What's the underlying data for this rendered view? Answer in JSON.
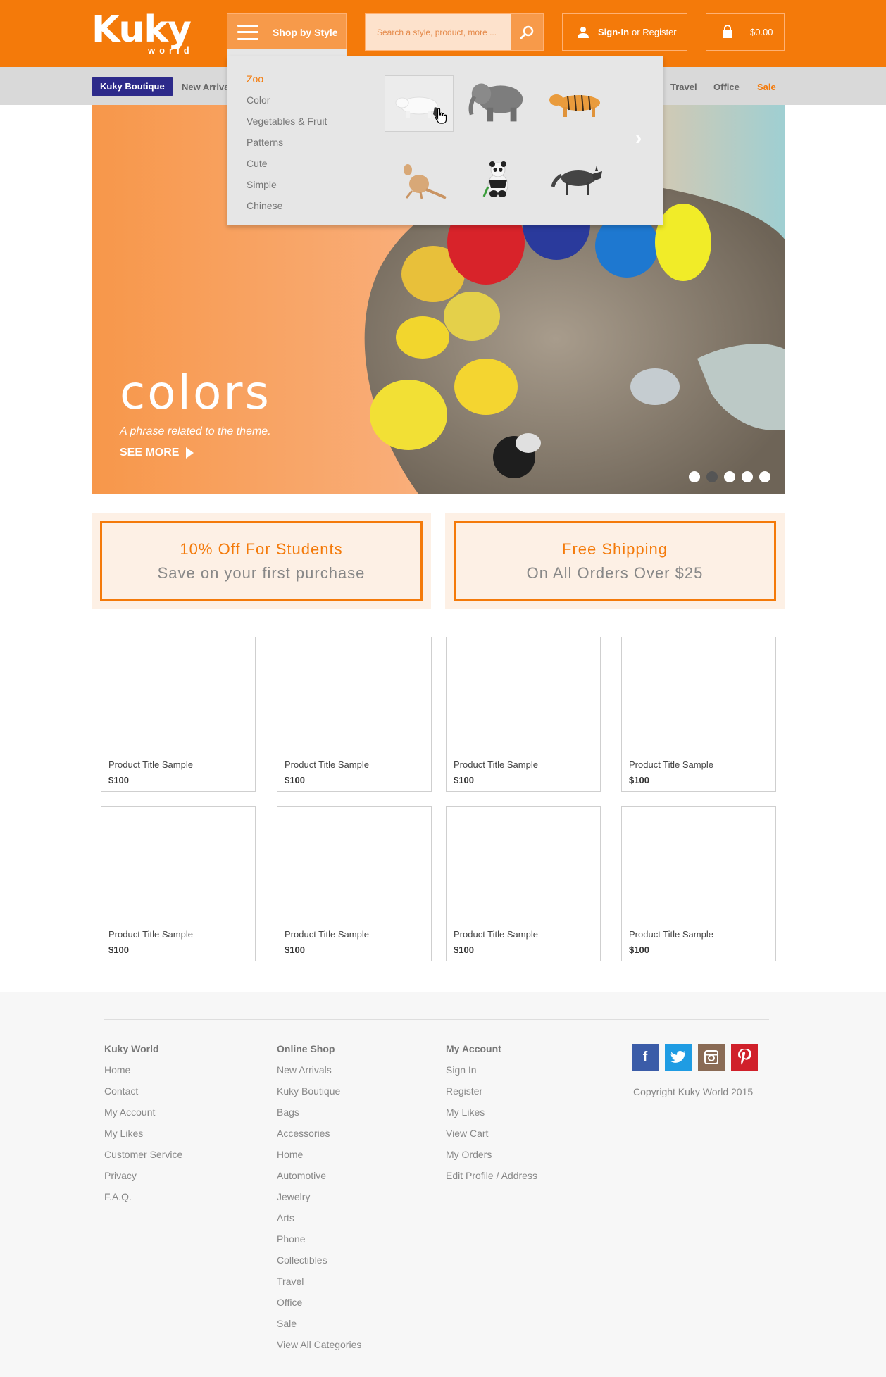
{
  "header": {
    "logo_main": "Kuky",
    "logo_sub": "world",
    "shop_by_style": "Shop by Style",
    "search_placeholder": "Search a style, product, more ...",
    "signin": "Sign-In",
    "or_register": "or Register",
    "cart_total": "$0.00"
  },
  "catbar": {
    "boutique": "Kuky Boutique",
    "new_arrivals": "New Arriva",
    "travel": "Travel",
    "office": "Office",
    "sale": "Sale"
  },
  "dropdown": {
    "items": [
      "Zoo",
      "Color",
      "Vegetables & Fruit",
      "Patterns",
      "Cute",
      "Simple",
      "Chinese"
    ],
    "active": "Zoo",
    "thumbnails": [
      "polar-bear",
      "elephant",
      "tiger",
      "kangaroo",
      "panda",
      "wolf"
    ]
  },
  "hero": {
    "title": "colors",
    "phrase": "A phrase related to the theme.",
    "see_more": "SEE MORE",
    "slides_total": 5,
    "active_slide": 2
  },
  "promos": [
    {
      "headline": "10% Off For Students",
      "sub": "Save on your first purchase"
    },
    {
      "headline": "Free Shipping",
      "sub": "On All Orders Over $25"
    }
  ],
  "products": [
    {
      "title": "Product Title Sample",
      "price": "$100"
    },
    {
      "title": "Product Title Sample",
      "price": "$100"
    },
    {
      "title": "Product Title Sample",
      "price": "$100"
    },
    {
      "title": "Product Title Sample",
      "price": "$100"
    },
    {
      "title": "Product Title Sample",
      "price": "$100"
    },
    {
      "title": "Product Title Sample",
      "price": "$100"
    },
    {
      "title": "Product Title Sample",
      "price": "$100"
    },
    {
      "title": "Product Title Sample",
      "price": "$100"
    }
  ],
  "footer": {
    "kuky_world": {
      "heading": "Kuky World",
      "links": [
        "Home",
        "Contact",
        "My Account",
        "My Likes",
        "Customer Service",
        "Privacy",
        "F.A.Q."
      ]
    },
    "online_shop": {
      "heading": "Online Shop",
      "links": [
        "New Arrivals",
        "Kuky Boutique",
        "Bags",
        "Accessories",
        "Home",
        "Automotive",
        "Jewelry",
        "Arts",
        "Phone",
        "Collectibles",
        "Travel",
        "Office",
        "Sale",
        "View All Categories"
      ]
    },
    "my_account": {
      "heading": "My Account",
      "links": [
        "Sign In",
        "Register",
        "My Likes",
        "View Cart",
        "My Orders",
        "Edit Profile / Address"
      ]
    },
    "social": [
      "facebook-icon",
      "twitter-icon",
      "instagram-icon",
      "pinterest-icon"
    ],
    "copyright": "Copyright Kuky World 2015"
  },
  "colors": {
    "brand_orange": "#f47a0a",
    "boutique_navy": "#2d2a8a",
    "facebook": "#3b5ca8",
    "twitter": "#1f9ce3",
    "instagram": "#8a6b55",
    "pinterest": "#d0202a"
  }
}
